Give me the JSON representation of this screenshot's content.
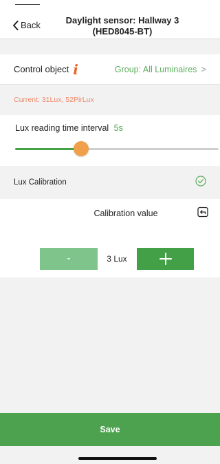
{
  "header": {
    "back_label": "Back",
    "title_line1": "Daylight sensor: Hallway 3",
    "title_line2": "(HED8045-BT)"
  },
  "control_object": {
    "label": "Control object",
    "info_glyph": "i",
    "value": "Group: All Luminaires",
    "chevron": ">"
  },
  "current": {
    "text": "Current: 31Lux,  52PirLux"
  },
  "lux_interval": {
    "label": "Lux reading time interval",
    "value": "5s",
    "slider_fraction": 0.33
  },
  "lux_calibration": {
    "label": "Lux Calibration",
    "enabled": true
  },
  "calibration": {
    "label": "Calibration value",
    "minus_label": "-",
    "value": "3 Lux"
  },
  "save": {
    "label": "Save"
  },
  "colors": {
    "accent_green": "#43a047",
    "light_green": "#7fc48a",
    "orange": "#f0a04b",
    "salmon": "#f08a6b",
    "info_orange": "#e8622a"
  },
  "icons": {
    "back": "chevron-left-icon",
    "info": "info-icon",
    "chevron": "chevron-right-icon",
    "check": "check-circle-icon",
    "reset": "reset-icon",
    "plus": "plus-icon"
  }
}
